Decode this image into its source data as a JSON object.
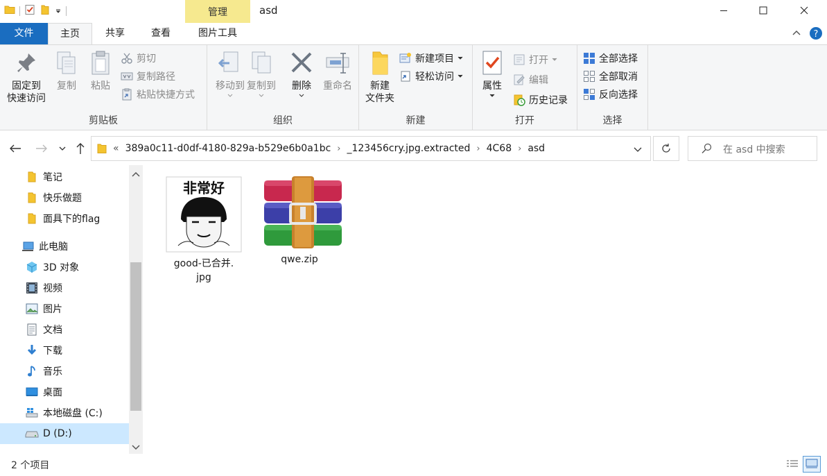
{
  "window": {
    "title": "asd",
    "context_tab_group": "管理"
  },
  "tabs": [
    {
      "label": "文件"
    },
    {
      "label": "主页"
    },
    {
      "label": "共享"
    },
    {
      "label": "查看"
    },
    {
      "label": "图片工具"
    }
  ],
  "ribbon": {
    "clipboard": {
      "label": "剪贴板",
      "pin_line1": "固定到",
      "pin_line2": "快速访问",
      "copy": "复制",
      "paste": "粘贴",
      "cut": "剪切",
      "copy_path": "复制路径",
      "paste_shortcut": "粘贴快捷方式"
    },
    "organize": {
      "label": "组织",
      "move_to": "移动到",
      "copy_to": "复制到",
      "delete": "删除",
      "rename": "重命名"
    },
    "new": {
      "label": "新建",
      "new_folder_line1": "新建",
      "new_folder_line2": "文件夹",
      "new_item": "新建项目",
      "easy_access": "轻松访问"
    },
    "open": {
      "label": "打开",
      "properties": "属性",
      "open": "打开",
      "edit": "编辑",
      "history": "历史记录"
    },
    "select": {
      "label": "选择",
      "select_all": "全部选择",
      "select_none": "全部取消",
      "invert": "反向选择"
    }
  },
  "address": {
    "prefix": "«",
    "crumbs": [
      "389a0c11-d0df-4180-829a-b529e6b0a1bc",
      "_123456cry.jpg.extracted",
      "4C68",
      "asd"
    ],
    "search_placeholder": "在 asd 中搜索"
  },
  "nav_pane": {
    "items": [
      {
        "label": "笔记",
        "icon": "folder-icon"
      },
      {
        "label": "快乐做题",
        "icon": "folder-icon"
      },
      {
        "label": "面具下的flag",
        "icon": "folder-icon"
      },
      {
        "label": "此电脑",
        "icon": "this-pc-icon"
      },
      {
        "label": "3D 对象",
        "icon": "3d-objects-icon"
      },
      {
        "label": "视频",
        "icon": "video-icon"
      },
      {
        "label": "图片",
        "icon": "pictures-icon"
      },
      {
        "label": "文档",
        "icon": "documents-icon"
      },
      {
        "label": "下载",
        "icon": "download-icon"
      },
      {
        "label": "音乐",
        "icon": "music-icon"
      },
      {
        "label": "桌面",
        "icon": "desktop-icon"
      },
      {
        "label": "本地磁盘 (C:)",
        "icon": "windows-drive-icon"
      },
      {
        "label": "D (D:)",
        "icon": "drive-icon"
      }
    ]
  },
  "files": [
    {
      "name_line1": "good-已合并.",
      "name_line2": "jpg",
      "thumb_text": "非常好"
    },
    {
      "name_line1": "qwe.zip",
      "name_line2": ""
    }
  ],
  "status": {
    "item_count": "2 个项目"
  },
  "colors": {
    "file_tab": "#1a6dc0",
    "context_tab": "#f6e98f",
    "selection": "#cce8ff"
  }
}
